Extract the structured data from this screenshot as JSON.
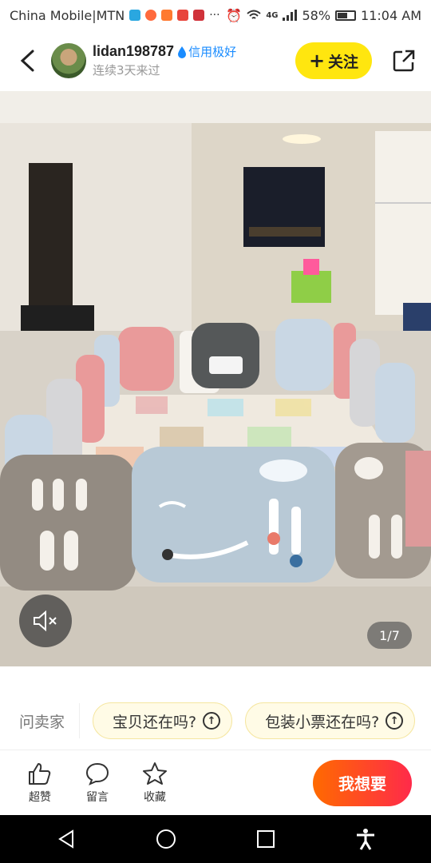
{
  "status_bar": {
    "carrier": "China Mobile|MTN",
    "network": "4G",
    "battery": "58%",
    "time": "11:04 AM"
  },
  "header": {
    "seller_name": "lidan198787",
    "credit_label": "信用极好",
    "subtitle": "连续3天来过",
    "follow_label": "关注"
  },
  "photo": {
    "page_indicator": "1/7"
  },
  "ask": {
    "label": "问卖家",
    "chips": [
      "宝贝还在吗?",
      "包装小票还在吗?"
    ]
  },
  "actions": {
    "like": "超赞",
    "comment": "留言",
    "favorite": "收藏",
    "want": "我想要"
  },
  "colors": {
    "follow": "#ffe60f",
    "want_start": "#ff6a00",
    "want_end": "#ff2a4a",
    "credit": "#1a8cff"
  }
}
